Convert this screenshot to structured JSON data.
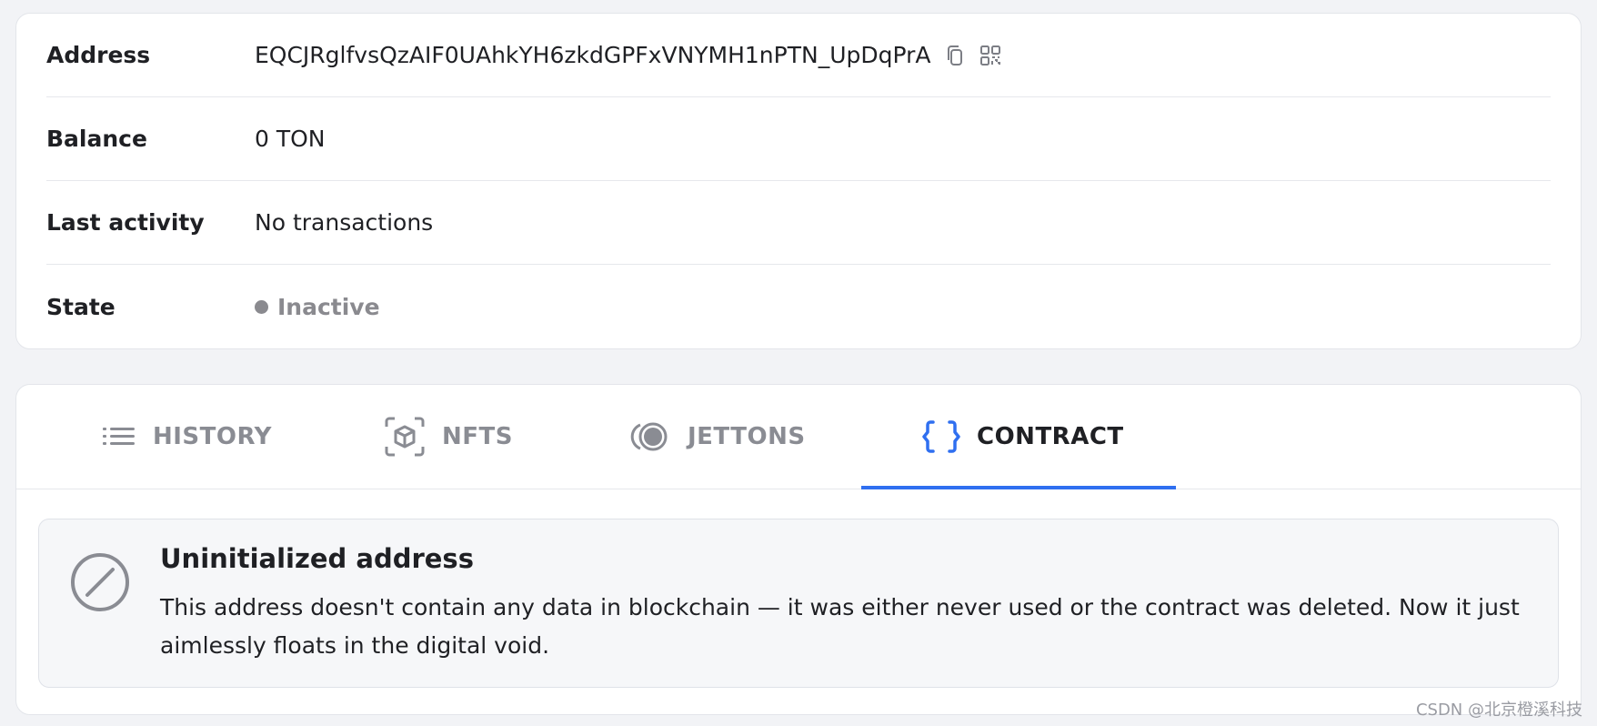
{
  "info": {
    "address_label": "Address",
    "address_value": "EQCJRglfvsQzAIF0UAhkYH6zkdGPFxVNYMH1nPTN_UpDqPrA",
    "balance_label": "Balance",
    "balance_value": "0 TON",
    "last_activity_label": "Last activity",
    "last_activity_value": "No transactions",
    "state_label": "State",
    "state_value": "Inactive",
    "state_color": "#8a8a8f"
  },
  "tabs": [
    {
      "label": "HISTORY",
      "icon": "list-icon",
      "active": false
    },
    {
      "label": "NFTS",
      "icon": "cube-icon",
      "active": false
    },
    {
      "label": "JETTONS",
      "icon": "coins-icon",
      "active": false
    },
    {
      "label": "CONTRACT",
      "icon": "braces-icon",
      "active": true
    }
  ],
  "accent_color": "#2f6ff0",
  "notice": {
    "icon": "prohibited-icon",
    "title": "Uninitialized address",
    "body": "This address doesn't contain any data in blockchain — it was either never used or the contract was deleted. Now it just aimlessly floats in the digital void."
  },
  "watermark": "CSDN @北京橙溪科技"
}
